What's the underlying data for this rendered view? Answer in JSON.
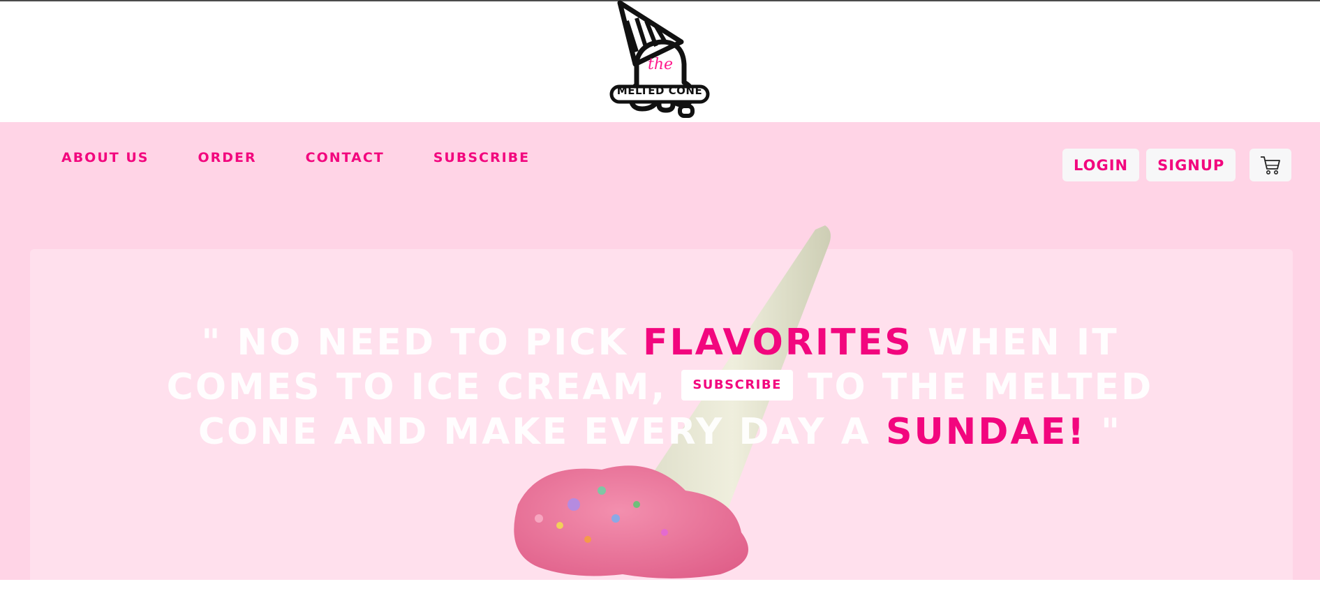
{
  "brand": {
    "name": "MELTED CONE",
    "script": "the"
  },
  "nav": {
    "items": [
      {
        "label": "ABOUT US"
      },
      {
        "label": "ORDER"
      },
      {
        "label": "CONTACT"
      },
      {
        "label": "SUBSCRIBE"
      }
    ]
  },
  "auth": {
    "login_label": "LOGIN",
    "signup_label": "SIGNUP",
    "cart_icon": "cart-icon"
  },
  "hero": {
    "quote_open": "\" NO NEED TO PICK ",
    "quote_highlight1": "FLAVORITES",
    "quote_mid1": " WHEN IT COMES TO ICE CREAM,",
    "subscribe_label": "SUBSCRIBE",
    "quote_mid2": " TO THE MELTED CONE AND MAKE EVERY DAY A ",
    "quote_highlight2": "SUNDAE!",
    "quote_close": " \""
  },
  "colors": {
    "accent": "#f2067e",
    "hero_bg": "#ffd4e6",
    "button_bg": "#f7f7f8"
  }
}
